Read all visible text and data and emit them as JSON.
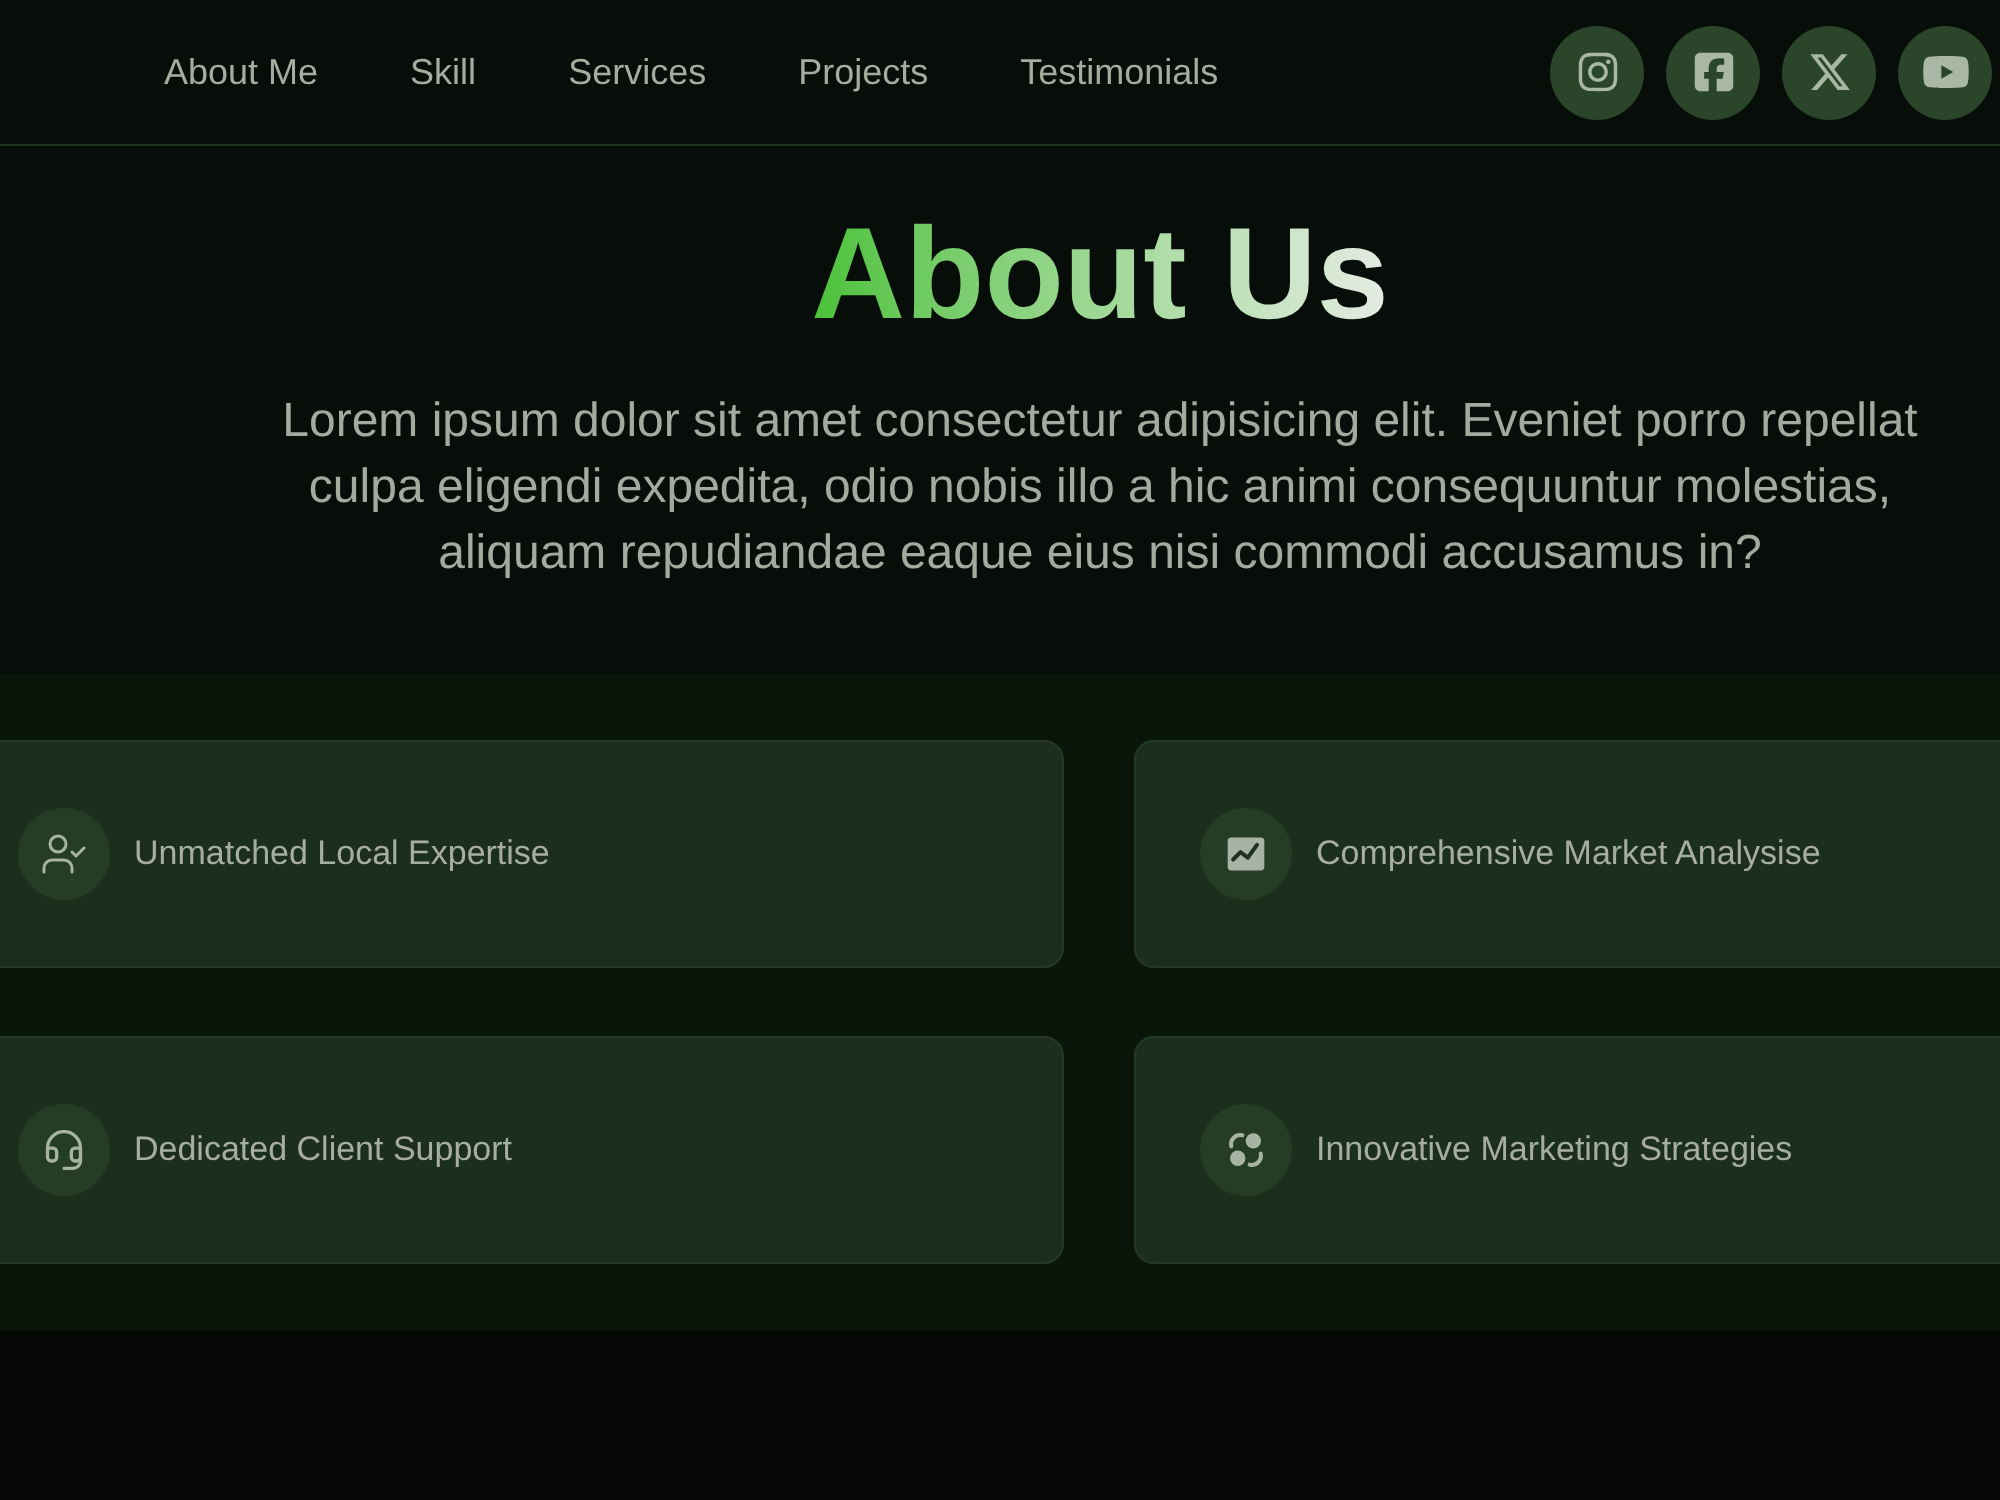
{
  "nav": {
    "links": [
      "About Me",
      "Skill",
      "Services",
      "Projects",
      "Testimonials"
    ],
    "social": [
      {
        "kind": "instagram"
      },
      {
        "kind": "facebook"
      },
      {
        "kind": "x"
      },
      {
        "kind": "youtube"
      }
    ]
  },
  "hero": {
    "title": "About Us",
    "text": "Lorem ipsum dolor sit amet consectetur adipisicing elit. Eveniet porro repellat culpa eligendi expedita, odio nobis illo a hic animi consequuntur molestias, aliquam repudiandae eaque eius nisi commodi accusamus in?"
  },
  "features": [
    {
      "kind": "user-check",
      "label": "Unmatched Local Expertise"
    },
    {
      "kind": "chart",
      "label": "Comprehensive Market Analysise"
    },
    {
      "kind": "headset",
      "label": "Dedicated Client Support"
    },
    {
      "kind": "shapes",
      "label": "Innovative Marketing Strategies"
    }
  ]
}
